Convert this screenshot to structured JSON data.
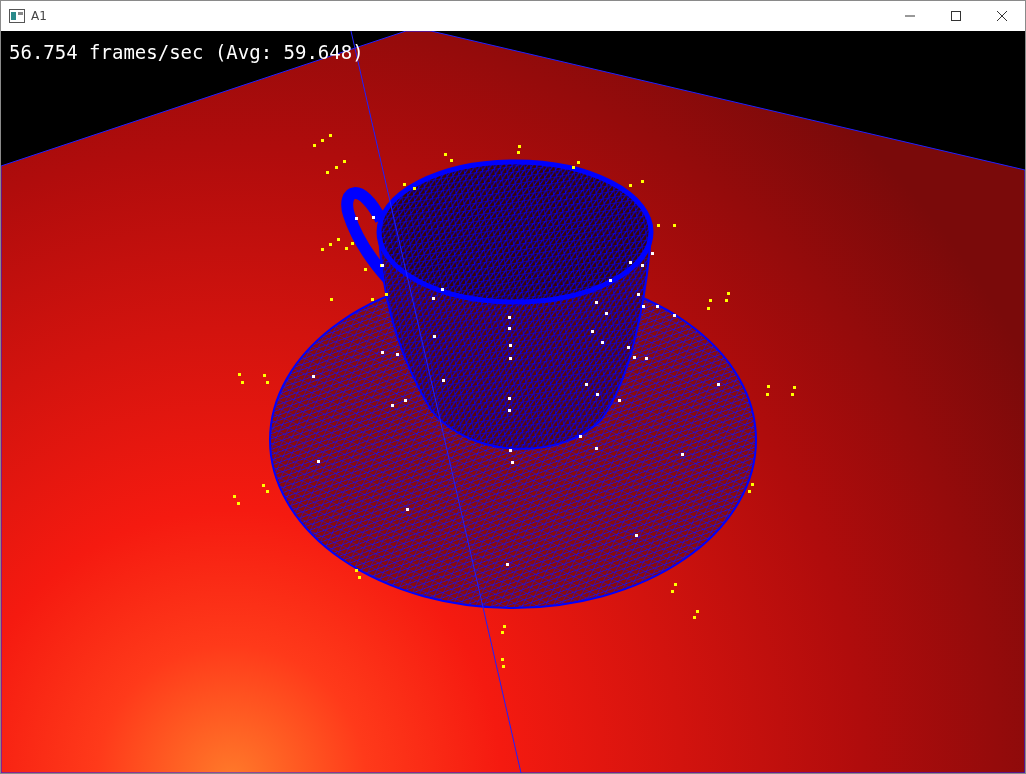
{
  "window": {
    "title": "A1"
  },
  "overlay": {
    "fps_text": "56.754 frames/sec (Avg: 59.648)"
  }
}
